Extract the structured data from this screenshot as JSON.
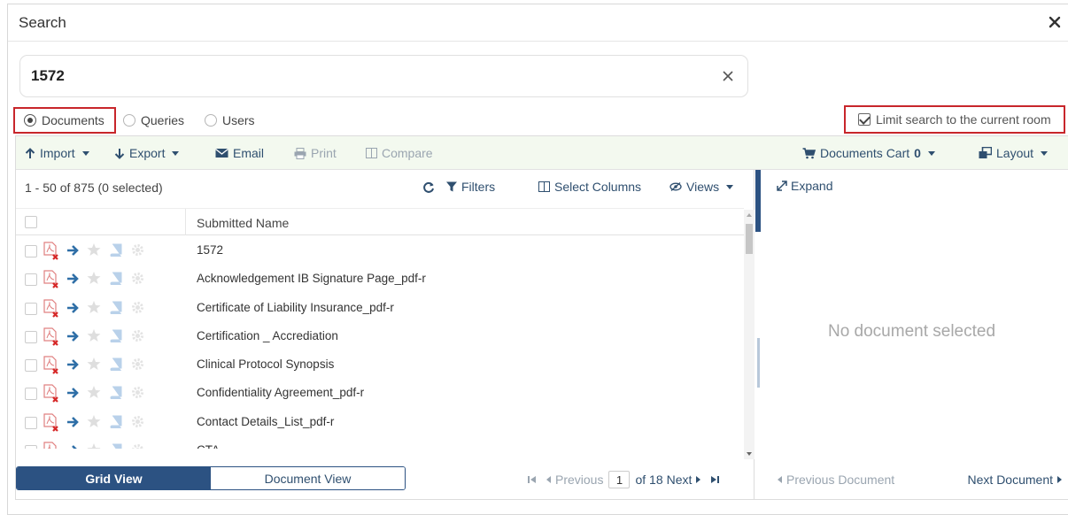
{
  "dialog": {
    "title": "Search"
  },
  "search": {
    "value": "1572"
  },
  "scope": {
    "options": [
      "Documents",
      "Queries",
      "Users"
    ],
    "selected": "Documents",
    "limit_label": "Limit search to the current room",
    "limit_checked": true
  },
  "toolbar": {
    "import": "Import",
    "export": "Export",
    "email": "Email",
    "print": "Print",
    "compare": "Compare",
    "cart_label": "Documents Cart",
    "cart_count": "0",
    "layout": "Layout"
  },
  "grid": {
    "count_text": "1 - 50 of 875 (0 selected)",
    "filters": "Filters",
    "select_columns": "Select Columns",
    "views": "Views",
    "column_header": "Submitted Name",
    "rows": [
      "1572",
      "Acknowledgement IB Signature Page_pdf-r",
      "Certificate of Liability Insurance_pdf-r",
      "Certification _ Accrediation",
      "Clinical Protocol Synopsis",
      "Confidentiality Agreement_pdf-r",
      "Contact Details_List_pdf-r",
      "CTA"
    ]
  },
  "views": {
    "grid": "Grid View",
    "document": "Document View",
    "active": "Grid View"
  },
  "pager": {
    "previous": "Previous",
    "current_page": "1",
    "of_text": "of 18",
    "next": "Next"
  },
  "preview": {
    "expand": "Expand",
    "empty_text": "No document selected",
    "prev_doc": "Previous Document",
    "next_doc": "Next Document"
  },
  "colors": {
    "accent": "#2c5282",
    "highlight_box": "#c8262b",
    "toolbar_bg": "#f3f9ef"
  }
}
